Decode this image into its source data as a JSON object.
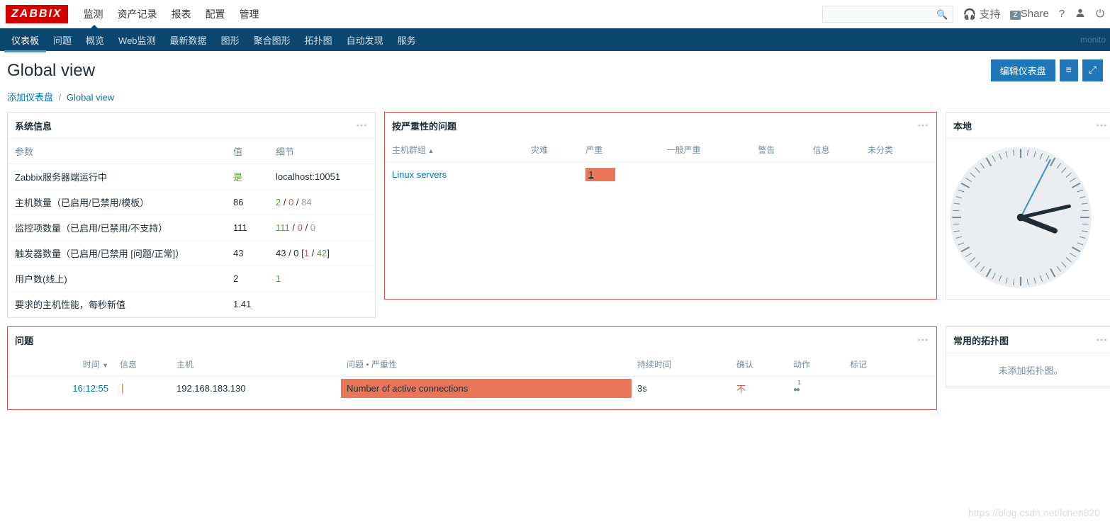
{
  "logo": "ZABBIX",
  "topnav": [
    "监测",
    "资产记录",
    "报表",
    "配置",
    "管理"
  ],
  "topnav_active": 0,
  "support_label": "支持",
  "share_label": "Share",
  "subnav": [
    "仪表板",
    "问题",
    "概览",
    "Web监测",
    "最新数据",
    "图形",
    "聚合图形",
    "拓扑图",
    "自动发现",
    "服务"
  ],
  "subnav_active": 0,
  "subnav_right": "monito",
  "page_title": "Global view",
  "edit_dashboard_label": "编辑仪表盘",
  "breadcrumb": {
    "root": "添加仪表盘",
    "current": "Global view"
  },
  "sysinfo": {
    "title": "系统信息",
    "cols": [
      "参数",
      "值",
      "细节"
    ],
    "rows": [
      {
        "param": "Zabbix服务器端运行中",
        "value_html": "<span class='c-green'>是</span>",
        "detail_html": "localhost:10051"
      },
      {
        "param": "主机数量（已启用/已禁用/模板）",
        "value_html": "86",
        "detail_html": "<span class='c-green'>2</span> / <span class='c-red'>0</span> / <span class='c-gray'>84</span>"
      },
      {
        "param": "监控项数量（已启用/已禁用/不支持）",
        "value_html": "111",
        "detail_html": "<span class='c-green'>111</span> / <span class='c-red'>0</span> / <span class='c-gray'>0</span>"
      },
      {
        "param": "触发器数量（已启用/已禁用 [问题/正常]）",
        "value_html": "43",
        "detail_html": "43 / 0 [<span class='c-red'>1</span> / <span class='c-green'>42</span>]"
      },
      {
        "param": "用户数(线上)",
        "value_html": "2",
        "detail_html": "<span class='c-green'>1</span>"
      },
      {
        "param": "要求的主机性能，每秒新值",
        "value_html": "1.41",
        "detail_html": ""
      }
    ]
  },
  "severity": {
    "title": "按严重性的问题",
    "cols": [
      "主机群组",
      "灾难",
      "严重",
      "一般严重",
      "警告",
      "信息",
      "未分类"
    ],
    "row": {
      "hostgroup": "Linux servers",
      "high": "1"
    }
  },
  "clock": {
    "title": "本地"
  },
  "problems": {
    "title": "问题",
    "cols": [
      "时间",
      "信息",
      "主机",
      "问题 • 严重性",
      "持续时间",
      "确认",
      "动作",
      "标记"
    ],
    "row": {
      "time": "16:12:55",
      "host": "192.168.183.130",
      "problem": "Number of active connections",
      "duration": "3s",
      "ack": "不",
      "action_count": "1"
    }
  },
  "favmaps": {
    "title": "常用的拓扑图",
    "empty": "未添加拓扑图。"
  },
  "watermark": "https://blog.csdn.net/lchen820"
}
